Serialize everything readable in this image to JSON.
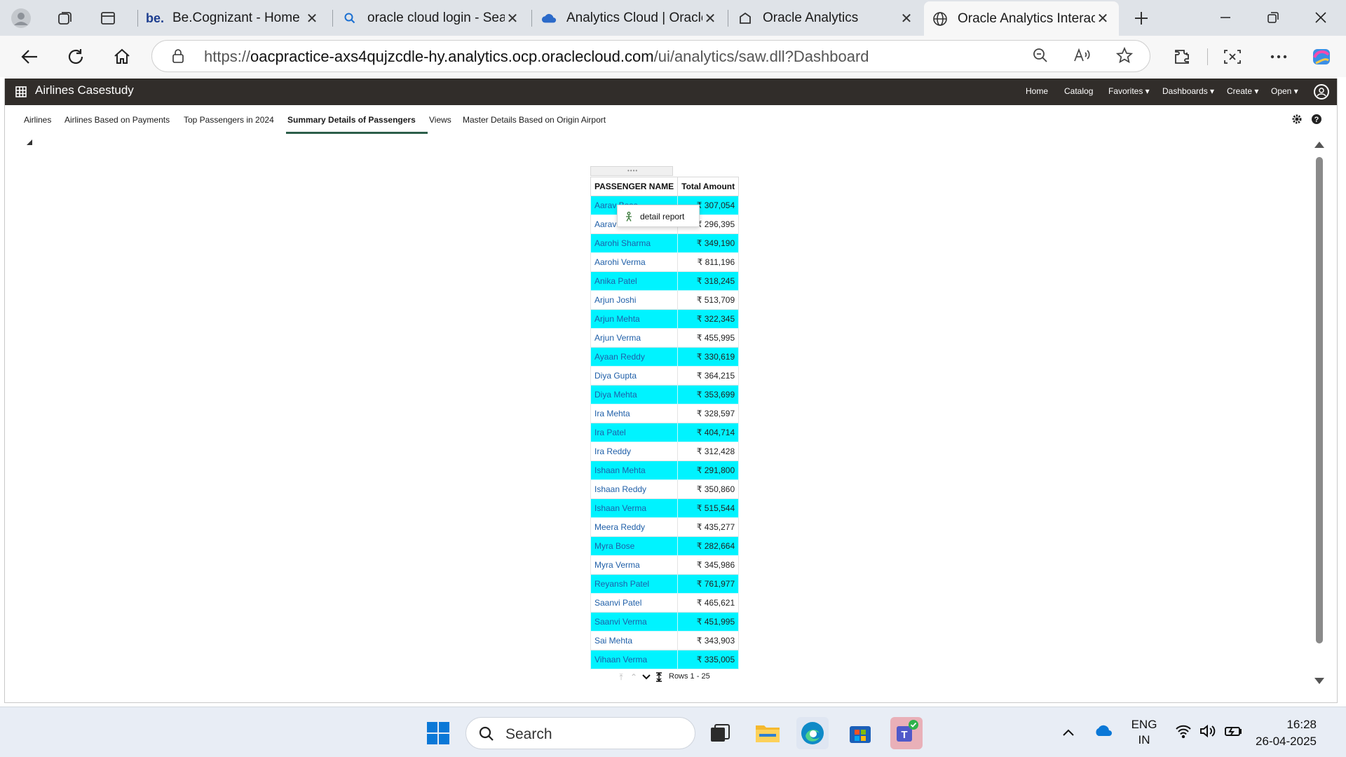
{
  "browser": {
    "tabs": [
      {
        "title": "Be.Cognizant - Home",
        "favicon": "be-logo-icon",
        "active": false
      },
      {
        "title": "oracle cloud login - Sea",
        "favicon": "search-icon",
        "active": false
      },
      {
        "title": "Analytics Cloud | Oracle",
        "favicon": "cloud-icon",
        "active": false
      },
      {
        "title": "Oracle Analytics",
        "favicon": "oracle-analytics-icon",
        "active": false
      },
      {
        "title": "Oracle Analytics Interac",
        "favicon": "globe-icon",
        "active": true
      }
    ],
    "url_prefix": "https://",
    "url_host": "oacpractice-axs4qujzcdle-hy.analytics.ocp.oraclecloud.com",
    "url_path": "/ui/analytics/saw.dll?Dashboard",
    "fav_glyph": "be."
  },
  "app": {
    "title": "Airlines Casestudy",
    "menu": {
      "home": "Home",
      "catalog": "Catalog",
      "favorites": "Favorites ▾",
      "dashboards": "Dashboards ▾",
      "create": "Create ▾",
      "open": "Open ▾"
    }
  },
  "page_tabs": [
    "Airlines",
    "Airlines Based on Payments",
    "Top Passengers in 2024",
    "Summary Details of Passengers",
    "Views",
    "Master Details Based on Origin Airport"
  ],
  "active_page_tab": "Summary Details of Passengers",
  "report": {
    "columns": [
      "PASSENGER NAME",
      "Total Amount"
    ],
    "rows": [
      {
        "name": "Aarav Bose",
        "amount": "₹ 307,054",
        "highlight": true
      },
      {
        "name": "Aarav Patel",
        "amount": "₹ 296,395",
        "highlight": false
      },
      {
        "name": "Aarohi Sharma",
        "amount": "₹ 349,190",
        "highlight": true
      },
      {
        "name": "Aarohi Verma",
        "amount": "₹ 811,196",
        "highlight": false
      },
      {
        "name": "Anika Patel",
        "amount": "₹ 318,245",
        "highlight": true
      },
      {
        "name": "Arjun Joshi",
        "amount": "₹ 513,709",
        "highlight": false
      },
      {
        "name": "Arjun Mehta",
        "amount": "₹ 322,345",
        "highlight": true
      },
      {
        "name": "Arjun Verma",
        "amount": "₹ 455,995",
        "highlight": false
      },
      {
        "name": "Ayaan Reddy",
        "amount": "₹ 330,619",
        "highlight": true
      },
      {
        "name": "Diya Gupta",
        "amount": "₹ 364,215",
        "highlight": false
      },
      {
        "name": "Diya Mehta",
        "amount": "₹ 353,699",
        "highlight": true
      },
      {
        "name": "Ira Mehta",
        "amount": "₹ 328,597",
        "highlight": false
      },
      {
        "name": "Ira Patel",
        "amount": "₹ 404,714",
        "highlight": true
      },
      {
        "name": "Ira Reddy",
        "amount": "₹ 312,428",
        "highlight": false
      },
      {
        "name": "Ishaan Mehta",
        "amount": "₹ 291,800",
        "highlight": true
      },
      {
        "name": "Ishaan Reddy",
        "amount": "₹ 350,860",
        "highlight": false
      },
      {
        "name": "Ishaan Verma",
        "amount": "₹ 515,544",
        "highlight": true
      },
      {
        "name": "Meera Reddy",
        "amount": "₹ 435,277",
        "highlight": false
      },
      {
        "name": "Myra Bose",
        "amount": "₹ 282,664",
        "highlight": true
      },
      {
        "name": "Myra Verma",
        "amount": "₹ 345,986",
        "highlight": false
      },
      {
        "name": "Reyansh Patel",
        "amount": "₹ 761,977",
        "highlight": true
      },
      {
        "name": "Saanvi Patel",
        "amount": "₹ 465,621",
        "highlight": false
      },
      {
        "name": "Saanvi Verma",
        "amount": "₹ 451,995",
        "highlight": true
      },
      {
        "name": "Sai Mehta",
        "amount": "₹ 343,903",
        "highlight": false
      },
      {
        "name": "Vihaan Verma",
        "amount": "₹ 335,005",
        "highlight": true
      }
    ],
    "pager_text": "Rows 1 - 25",
    "highlight_color": "#00f3ff",
    "link_color": "#1f5fa8"
  },
  "context_menu": {
    "item": "detail report",
    "icon": "action-link-icon"
  },
  "taskbar": {
    "search_placeholder": "Search",
    "lang_line1": "ENG",
    "lang_line2": "IN",
    "time": "16:28",
    "date": "26-04-2025"
  },
  "colors": {
    "app_header_bg": "#312d2a",
    "active_tab_underline": "#2c5e4a"
  }
}
